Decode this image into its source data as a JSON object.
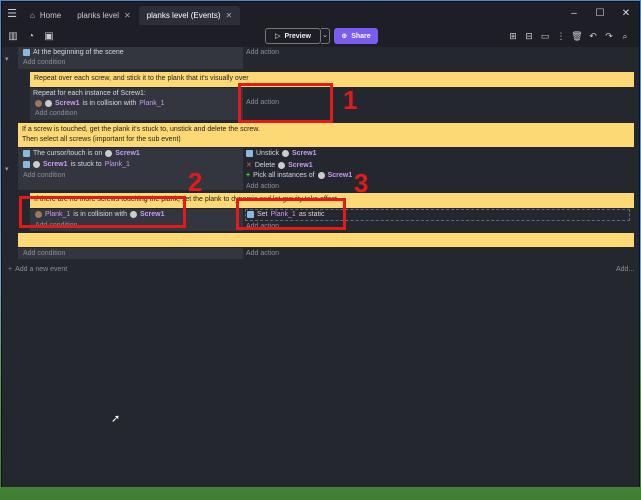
{
  "titlebar": {
    "tabs": [
      {
        "label": "Home"
      },
      {
        "label": "planks level"
      },
      {
        "label": "planks level (Events)"
      }
    ],
    "close_glyph": "✕"
  },
  "toolbar": {
    "preview_label": "Preview",
    "share_label": "Share"
  },
  "events": {
    "e1_condition": "At the beginning of the scene",
    "add_condition": "Add condition",
    "add_action": "Add action",
    "comment1": "Repeat over each screw, and stick it to the plank that it's visually over",
    "repeat_label": "Repeat for each instance of Screw1:",
    "c2_obj1": "Screw1",
    "c2_mid": "is in collision with",
    "c2_obj2": "Plank_1",
    "comment2_line1": "If a screw is touched, get the plank it's stuck to, unstick and delete the screw.",
    "comment2_line2": "Then select all screws (important for the sub event)",
    "c3_pre": "The cursor/touch is on",
    "c3_obj": "Screw1",
    "c4_obj": "Screw1",
    "c4_mid": "is stuck to",
    "c4_obj2": "Plank_1",
    "a1_label": "Unstick",
    "a1_obj": "Screw1",
    "a2_label": "Delete",
    "a2_obj": "Screw1",
    "a3_label": "Pick all instances of",
    "a3_obj": "Screw1",
    "comment3": "If there are no more screws touching the plank, set the plank to dynamic and let gravity take effect",
    "c5_obj1": "Plank_1",
    "c5_mid": "is in collision with",
    "c5_obj2": "Screw1",
    "a4_pre": "Set",
    "a4_obj": "Plank_1",
    "a4_post": "as static",
    "add_new_event": "Add a new event",
    "add_more": "Add..."
  },
  "annotations": [
    "1",
    "2",
    "3"
  ],
  "colors": {
    "comment_bg": "#fcd974",
    "highlight": "#e21a1a",
    "share": "#7b5cf0",
    "object": "#c89cf6"
  }
}
